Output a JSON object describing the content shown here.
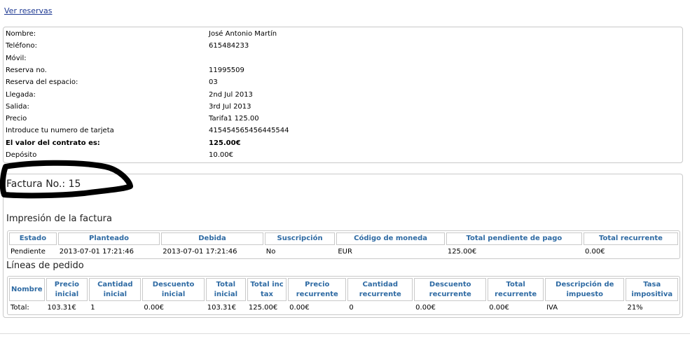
{
  "top_link": "Ver reservas",
  "details": [
    {
      "label": "Nombre:",
      "value": "José Antonio Martín",
      "bold": false
    },
    {
      "label": "Teléfono:",
      "value": "615484233",
      "bold": false
    },
    {
      "label": "Móvil:",
      "value": "",
      "bold": false
    },
    {
      "label": "Reserva no.",
      "value": "11995509",
      "bold": false
    },
    {
      "label": "Reserva del espacio:",
      "value": "03",
      "bold": false
    },
    {
      "label": "Llegada:",
      "value": "2nd Jul 2013",
      "bold": false
    },
    {
      "label": "Salida:",
      "value": "3rd Jul 2013",
      "bold": false
    },
    {
      "label": "Precio",
      "value": "Tarifa1 125.00",
      "bold": false
    },
    {
      "label": "Introduce tu numero de tarjeta",
      "value": "415454565456445544",
      "bold": false
    },
    {
      "label": "El valor del contrato es:",
      "value": "125.00€",
      "bold": true
    },
    {
      "label": "Depósito",
      "value": "10.00€",
      "bold": false
    }
  ],
  "invoice": {
    "title": "Factura No.: 15",
    "print_section": "Impresión de la factura",
    "print_table": {
      "headers": [
        "Estado",
        "Planteado",
        "Debida",
        "Suscripción",
        "Código de moneda",
        "Total pendiente de pago",
        "Total recurrente"
      ],
      "rows": [
        [
          "Pendiente",
          "2013-07-01 17:21:46",
          "2013-07-01 17:21:46",
          "No",
          "EUR",
          "125.00€",
          "0.00€"
        ]
      ]
    },
    "lines_section": "Líneas de pedido",
    "lines_table": {
      "headers": [
        "Nombre",
        "Precio inicial",
        "Cantidad inicial",
        "Descuento inicial",
        "Total inicial",
        "Total inc tax",
        "Precio recurrente",
        "Cantidad recurrente",
        "Descuento recurrente",
        "Total recurrente",
        "Descripción de impuesto",
        "Tasa impositiva"
      ],
      "rows": [
        [
          "Total:",
          "103.31€",
          "1",
          "0.00€",
          "103.31€",
          "125.00€",
          "0.00€",
          "0",
          "0.00€",
          "0.00€",
          "IVA",
          "21%"
        ]
      ]
    }
  },
  "colors": {
    "link": "#1f3a93",
    "header_text": "#2e6aa3",
    "border": "#c9c9c9",
    "scribble": "#000000"
  }
}
